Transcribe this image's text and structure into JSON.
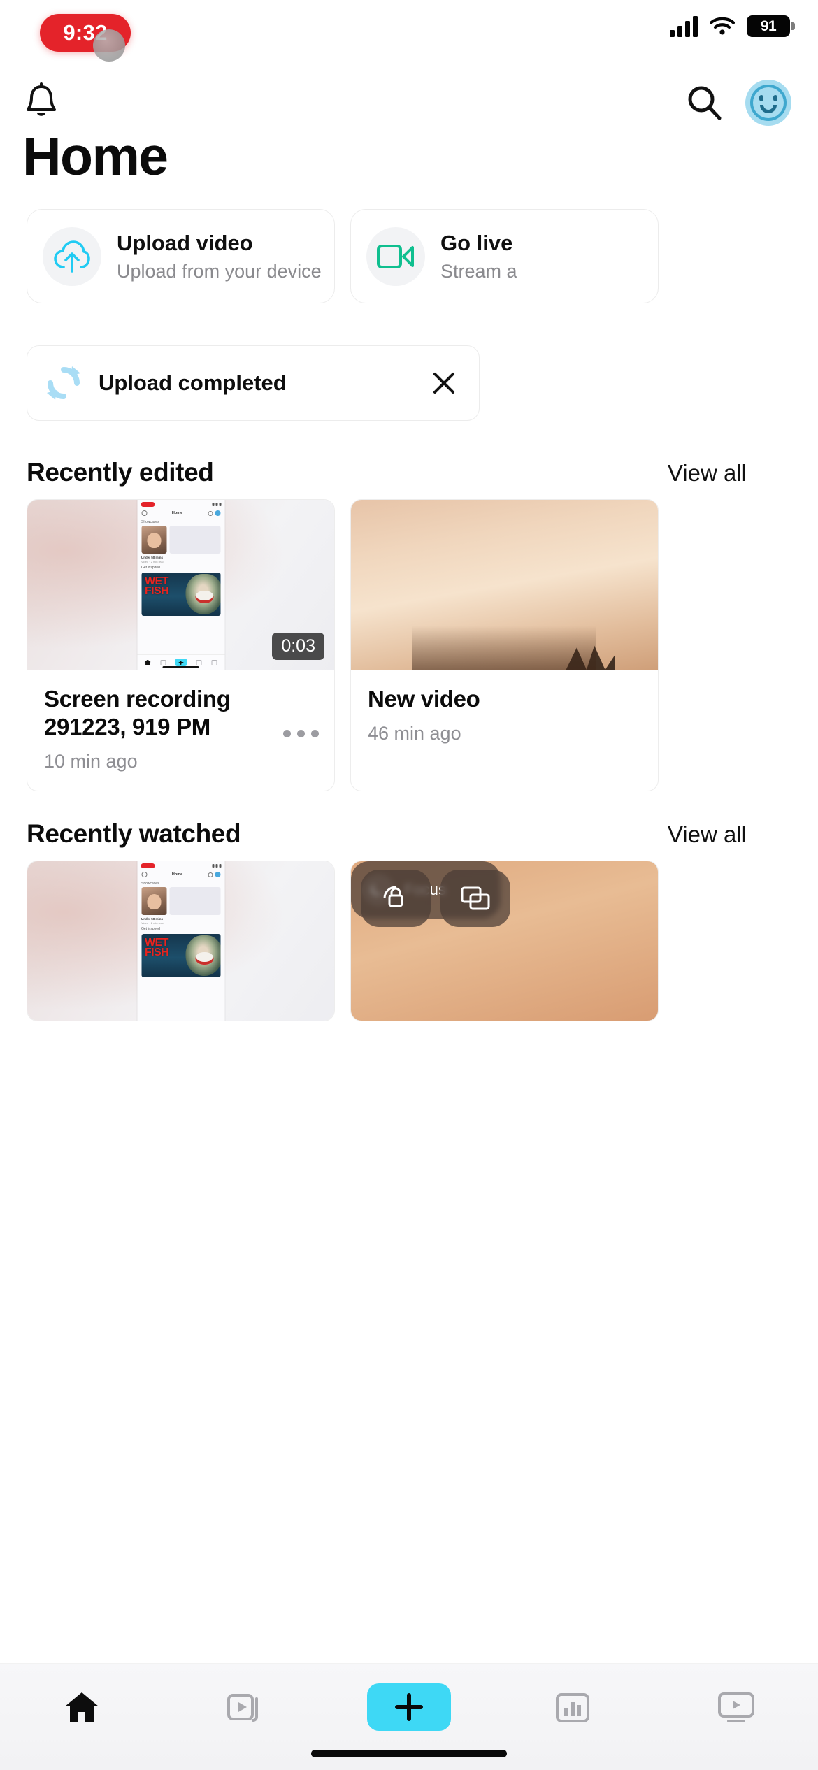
{
  "status_bar": {
    "time": "9:32",
    "battery_level": "91",
    "cellular_icon": "cellular-bars-icon",
    "wifi_icon": "wifi-icon",
    "battery_icon": "battery-icon"
  },
  "header": {
    "notifications_icon": "bell-icon",
    "search_icon": "search-icon",
    "avatar_icon": "avatar-face-icon",
    "title": "Home"
  },
  "action_cards": [
    {
      "title": "Upload video",
      "subtitle": "Upload from your device",
      "icon": "cloud-upload-icon",
      "icon_color": "#21CBF3"
    },
    {
      "title": "Go live",
      "subtitle": "Stream a",
      "icon": "video-camera-icon",
      "icon_color": "#0FBF8F"
    }
  ],
  "upload_banner": {
    "label": "Upload completed",
    "icon": "sync-refresh-icon",
    "icon_color": "#9FD8F2",
    "close_icon": "close-icon"
  },
  "sections": [
    {
      "title": "Recently edited",
      "view_all_label": "View all",
      "items": [
        {
          "title": "Screen recording 291223, 919 PM",
          "timestamp": "10 min ago",
          "duration": "0:03",
          "thumbnail": "screen-recording-thumbnail",
          "more_icon": "more-options-icon"
        },
        {
          "title": "New video",
          "timestamp": "46 min ago",
          "duration": "",
          "thumbnail": "room-video-thumbnail",
          "more_icon": "more-options-icon"
        }
      ]
    },
    {
      "title": "Recently watched",
      "view_all_label": "View all",
      "items": [
        {
          "title": "",
          "timestamp": "",
          "duration": "",
          "thumbnail": "screen-recording-thumbnail",
          "more_icon": "more-options-icon"
        },
        {
          "title": "",
          "timestamp": "",
          "duration": "",
          "thumbnail": "control-center-thumbnail",
          "more_icon": "more-options-icon"
        }
      ]
    }
  ],
  "thumbnail_overlay": {
    "focus_label": "Focus",
    "lock_rotation_icon": "rotation-lock-icon",
    "screen_mirror_icon": "screen-mirroring-icon",
    "moon_icon": "moon-icon",
    "poster_text_line1": "WET",
    "poster_text_line2": "FISH",
    "inner_nav_section": "Showcases",
    "inner_nav_section2": "Get inspired",
    "inner_title": "Home",
    "inner_item_title": "Under 50 mins",
    "inner_item_sub": "Video · 2 min read"
  },
  "tab_bar": {
    "items": [
      {
        "name": "home-tab",
        "icon": "home-icon",
        "active": true
      },
      {
        "name": "clips-tab",
        "icon": "clips-stack-icon",
        "active": false
      },
      {
        "name": "create-tab",
        "icon": "plus-icon",
        "active": false
      },
      {
        "name": "stats-tab",
        "icon": "bar-chart-icon",
        "active": false
      },
      {
        "name": "player-tab",
        "icon": "media-player-icon",
        "active": false
      }
    ],
    "accent_color": "#3ED8F5"
  }
}
